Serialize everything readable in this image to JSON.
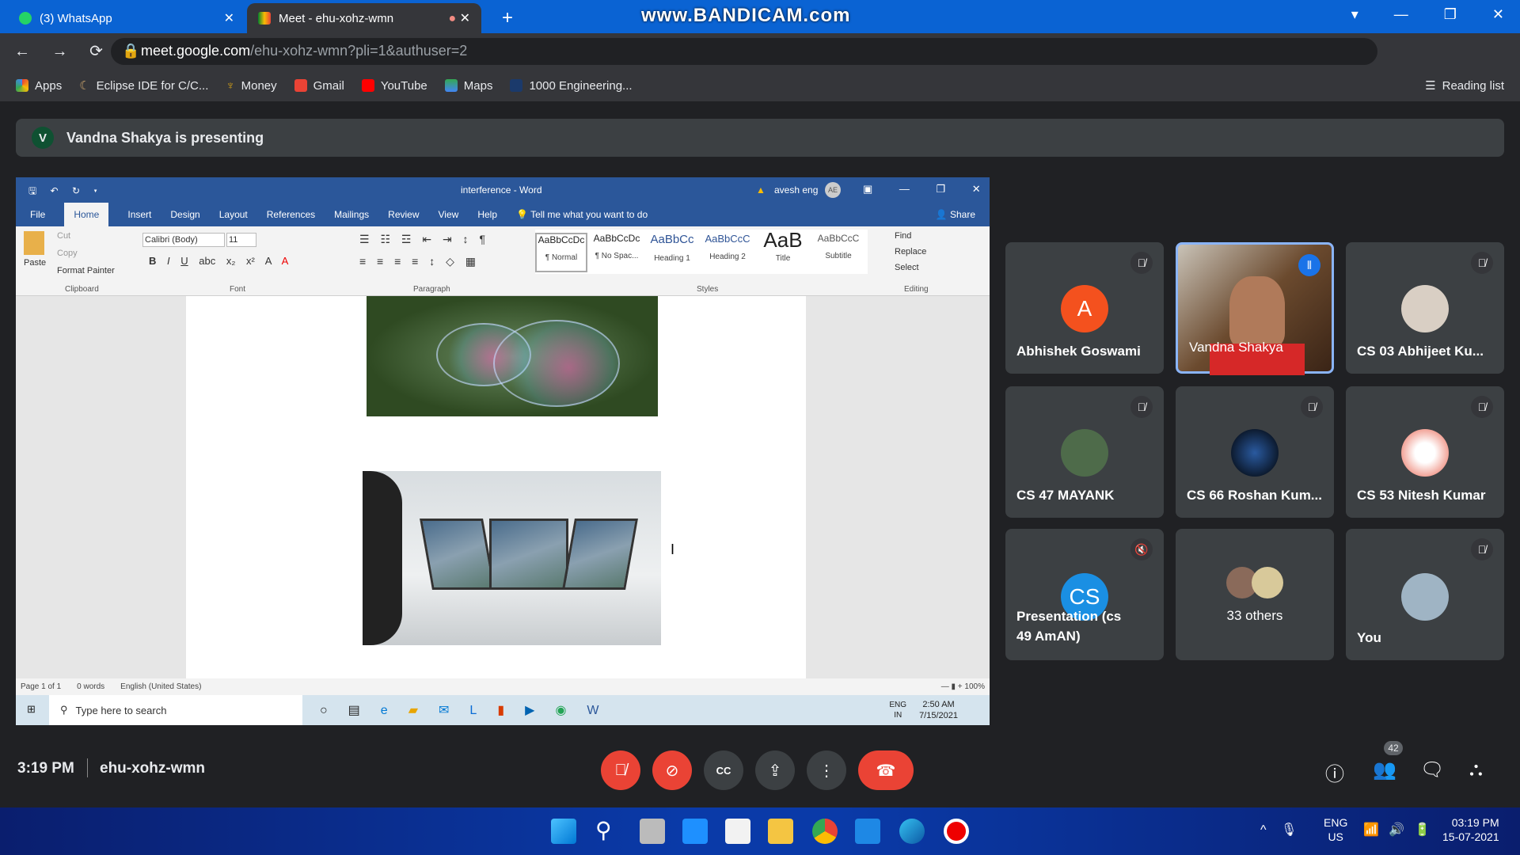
{
  "browser": {
    "tabs": [
      {
        "label": "(3) WhatsApp",
        "active": false
      },
      {
        "label": "Meet - ehu-xohz-wmn",
        "active": true
      }
    ],
    "watermark": "www.BANDICAM.com",
    "url_host": "meet.google.com",
    "url_path": "/ehu-xohz-wmn?pli=1&authuser=2",
    "bookmarks": [
      "Apps",
      "Eclipse IDE for C/C...",
      "Money",
      "Gmail",
      "YouTube",
      "Maps",
      "1000 Engineering..."
    ],
    "reading_list": "Reading list"
  },
  "banner": {
    "avatar": "V",
    "text": "Vandna Shakya is presenting"
  },
  "word": {
    "title": "interference - Word",
    "user": "avesh eng",
    "user_initials": "AE",
    "tabs": [
      "File",
      "Home",
      "Insert",
      "Design",
      "Layout",
      "References",
      "Mailings",
      "Review",
      "View",
      "Help"
    ],
    "tell_me": "Tell me what you want to do",
    "share": "Share",
    "clipboard": {
      "paste": "Paste",
      "cut": "Cut",
      "copy": "Copy",
      "format_painter": "Format Painter",
      "label": "Clipboard"
    },
    "font": {
      "name": "Calibri (Body)",
      "size": "11",
      "label": "Font"
    },
    "paragraph_label": "Paragraph",
    "styles": [
      {
        "preview": "AaBbCcDc",
        "name": "¶ Normal"
      },
      {
        "preview": "AaBbCcDc",
        "name": "¶ No Spac..."
      },
      {
        "preview": "AaBbCc",
        "name": "Heading 1"
      },
      {
        "preview": "AaBbCcC",
        "name": "Heading 2"
      },
      {
        "preview": "AaB",
        "name": "Title"
      },
      {
        "preview": "AaBbCcC",
        "name": "Subtitle"
      }
    ],
    "styles_label": "Styles",
    "editing": {
      "find": "Find",
      "replace": "Replace",
      "select": "Select",
      "label": "Editing"
    },
    "status": {
      "page": "Page 1 of 1",
      "words": "0 words",
      "language": "English (United States)",
      "zoom": "100%"
    },
    "taskbar": {
      "search_placeholder": "Type here to search",
      "lang1": "ENG",
      "lang2": "IN",
      "time": "2:50 AM",
      "date": "7/15/2021"
    }
  },
  "participants": [
    {
      "name": "Abhishek Goswami",
      "avatar": "A",
      "color": "#f4511e",
      "muted": true
    },
    {
      "name": "Vandna Shakya",
      "video": true,
      "speaking": true
    },
    {
      "name": "CS 03 Abhijeet Ku...",
      "muted": true
    },
    {
      "name": "CS 47 MAYANK",
      "muted": true
    },
    {
      "name": "CS 66 Roshan Kum...",
      "muted": true
    },
    {
      "name": "CS 53 Nitesh Kumar",
      "muted": true
    },
    {
      "name": "Presentation (cs 49 AmAN)",
      "avatar": "CS",
      "color": "#1a8fe3",
      "audio_muted": true
    },
    {
      "name": "33 others"
    },
    {
      "name": "You",
      "muted": true
    }
  ],
  "meeting": {
    "time": "3:19 PM",
    "code": "ehu-xohz-wmn",
    "participant_count": "42"
  },
  "os": {
    "lang1": "ENG",
    "lang2": "US",
    "time": "03:19 PM",
    "date": "15-07-2021"
  },
  "colors": {
    "end_call": "#ea4335",
    "word_blue": "#2b579a",
    "meet_bg": "#202124",
    "speaking_border": "#8ab4f8"
  }
}
